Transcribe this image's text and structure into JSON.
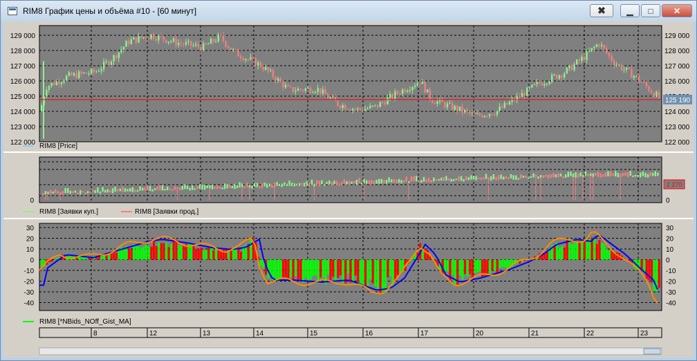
{
  "window": {
    "title": "RIM8 График цены и объёма #10 - [60 минут]",
    "buttons": {
      "pin": "✖",
      "minimize": "▁",
      "maximize": "□",
      "close": "✕"
    }
  },
  "colors": {
    "plot_bg": "#808080",
    "up": "#90ee90",
    "down": "#f08080",
    "bar_up": "#00ff00",
    "bar_down": "#ff0000",
    "line_blue": "#0000ff",
    "line_orange": "#ff8c00",
    "price_line": "#ff0000",
    "price_tag_bg": "#7090b0"
  },
  "price_panel": {
    "legend": "RIM8 [Price]",
    "last_price": "125 190",
    "ticks": [
      "129 000",
      "128 000",
      "127 000",
      "126 000",
      "125 000",
      "124 000",
      "123 000",
      "122 000"
    ]
  },
  "volume_panel": {
    "legend_buy": "RIM8 [Заявки куп.]",
    "legend_sell": "RIM8 [Заявки прод.]",
    "ticks": [
      "0"
    ],
    "value_tag": "2 270"
  },
  "osc_panel": {
    "legend": "RIM8 [*NBids_NOff_Gist_MA]",
    "ticks": [
      "30",
      "20",
      "10",
      "0",
      "-10",
      "-20",
      "-30",
      "-40"
    ]
  },
  "x_axis": {
    "labels": [
      "8",
      "12",
      "13",
      "14",
      "15",
      "16",
      "17",
      "20",
      "21",
      "22",
      "23"
    ]
  }
}
